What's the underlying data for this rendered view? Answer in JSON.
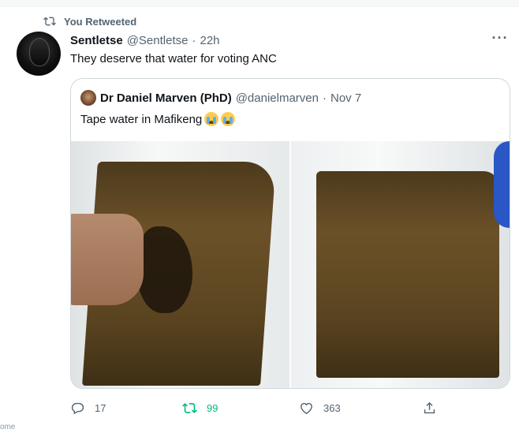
{
  "retweet_banner": {
    "icon": "retweet-icon",
    "text": "You Retweeted"
  },
  "tweet": {
    "author_name": "Sentletse",
    "author_handle": "@Sentletse",
    "separator": "·",
    "time": "22h",
    "more_icon": "more-icon",
    "text": "They deserve that water for voting ANC"
  },
  "quote": {
    "author_name": "Dr Daniel Marven (PhD)",
    "author_handle": "@danielmarven",
    "separator": "·",
    "time": "Nov 7",
    "text": "Tape water in Mafikeng",
    "emoji": [
      "loudly-crying-face",
      "loudly-crying-face"
    ],
    "photos": [
      "photo-dirty-water-1",
      "photo-dirty-water-2"
    ]
  },
  "actions": {
    "reply_count": "17",
    "retweet_count": "99",
    "like_count": "363",
    "retweet_color": "#00ba7c"
  },
  "footer": {
    "cut_text": "ome"
  }
}
